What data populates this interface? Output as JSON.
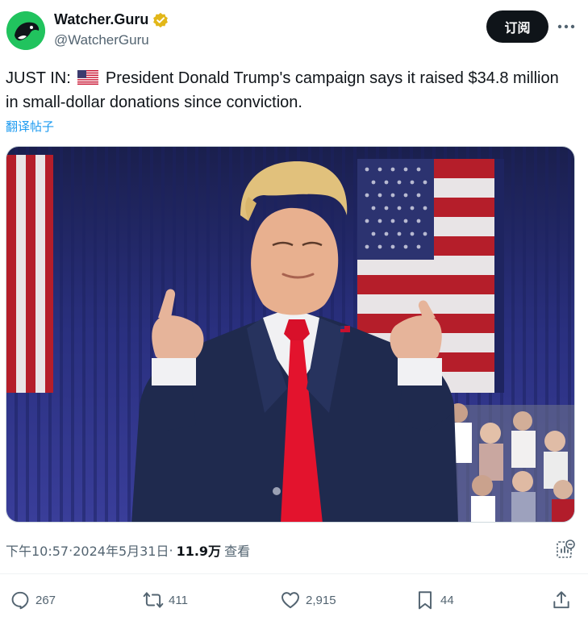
{
  "author": {
    "display_name": "Watcher.Guru",
    "handle": "@WatcherGuru",
    "verified_icon": "verified-gold-badge-icon"
  },
  "header": {
    "subscribe_label": "订阅",
    "more_icon": "more-dots-icon"
  },
  "tweet": {
    "prefix": "JUST IN: ",
    "flag_icon": "us-flag-emoji-icon",
    "body": " President Donald Trump's campaign says it raised $34.8 million in small-dollar donations since conviction.",
    "translate_label": "翻译帖子"
  },
  "meta": {
    "time": "下午10:57",
    "separator1": " · ",
    "date": "2024年5月31日",
    "separator2": " · ",
    "views_count": "11.9万",
    "views_label": "查看"
  },
  "actions": {
    "replies": "267",
    "reposts": "411",
    "likes": "2,915",
    "bookmarks": "44"
  },
  "colors": {
    "link": "#1d9bf0",
    "secondary_text": "#536471",
    "avatar_green": "#21c35e",
    "verified_gold": "#e2b719"
  }
}
